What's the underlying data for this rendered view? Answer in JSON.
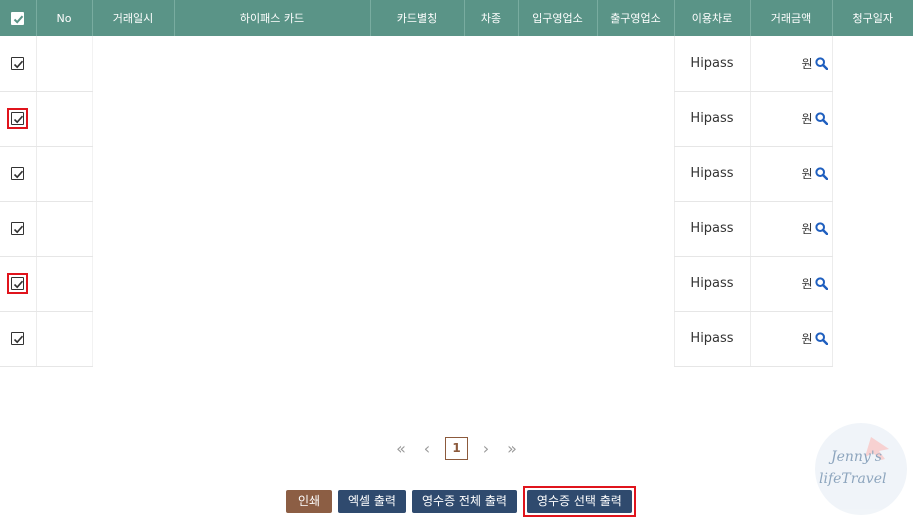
{
  "table": {
    "headers": [
      "No",
      "거래일시",
      "하이패스 카드",
      "카드별칭",
      "차종",
      "입구영업소",
      "출구영업소",
      "이용차로",
      "거래금액",
      "청구일자"
    ],
    "rows": [
      {
        "route": "Hipass",
        "amount_unit": "원",
        "checked": true,
        "highlighted": false
      },
      {
        "route": "Hipass",
        "amount_unit": "원",
        "checked": true,
        "highlighted": true
      },
      {
        "route": "Hipass",
        "amount_unit": "원",
        "checked": true,
        "highlighted": false
      },
      {
        "route": "Hipass",
        "amount_unit": "원",
        "checked": true,
        "highlighted": false
      },
      {
        "route": "Hipass",
        "amount_unit": "원",
        "checked": true,
        "highlighted": true
      },
      {
        "route": "Hipass",
        "amount_unit": "원",
        "checked": true,
        "highlighted": false
      }
    ]
  },
  "pagination": {
    "current_page": "1"
  },
  "buttons": {
    "print": "인쇄",
    "excel": "엑셀 출력",
    "print_all_receipts": "영수증 전체 출력",
    "print_selected_receipts": "영수증 선택 출력"
  },
  "watermark": {
    "line1": "Jenny's",
    "line2": "lifeTravel"
  },
  "colors": {
    "header_bg": "#5a9487",
    "highlight": "#e0141c",
    "navy_button": "#2f4a6e",
    "brown_button": "#8c5e44",
    "search_icon": "#1f5fbf"
  }
}
